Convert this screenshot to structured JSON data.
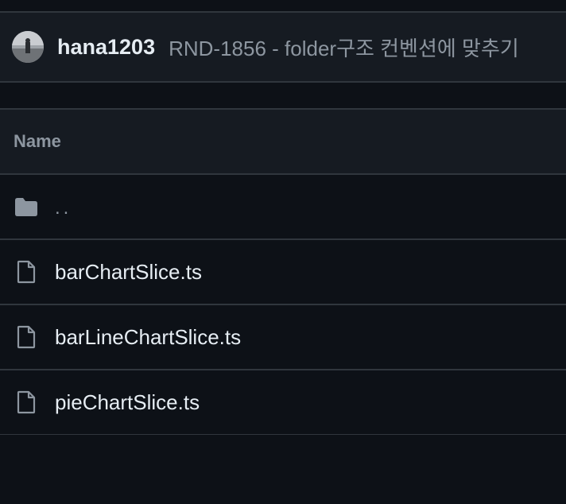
{
  "commit": {
    "author": "hana1203",
    "message": "RND-1856 - folder구조 컨벤션에 맞추기"
  },
  "table": {
    "header": "Name",
    "rows": [
      {
        "label": "..",
        "icon": "folder-icon"
      },
      {
        "label": "barChartSlice.ts",
        "icon": "file-icon"
      },
      {
        "label": "barLineChartSlice.ts",
        "icon": "file-icon"
      },
      {
        "label": "pieChartSlice.ts",
        "icon": "file-icon"
      }
    ]
  },
  "colors": {
    "background": "#0d1117",
    "header_bg": "#161b22",
    "border": "#30363d",
    "muted_text": "#8d96a0",
    "text": "#e6edf3"
  }
}
